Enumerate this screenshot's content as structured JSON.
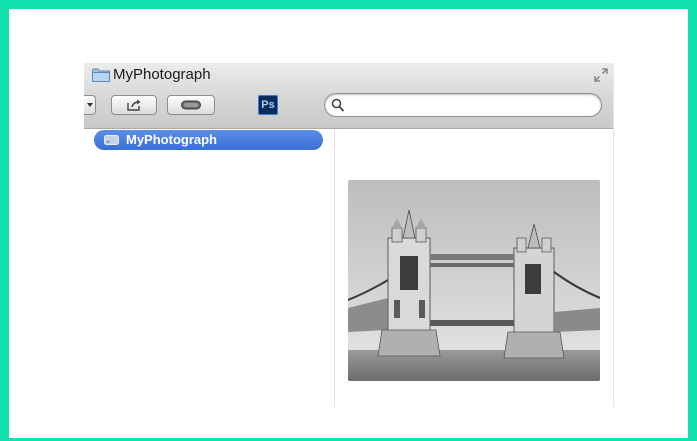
{
  "window": {
    "title": "MyPhotograph"
  },
  "toolbar": {
    "ps_label": "Ps",
    "search": {
      "value": "",
      "placeholder": ""
    }
  },
  "sidebar": {
    "items": [
      {
        "label": "MyPhotograph",
        "selected": true,
        "icon": "drive-icon"
      }
    ]
  },
  "preview": {
    "image": "tower-bridge-photo-grayscale"
  },
  "colors": {
    "frame_border": "#12e3ae",
    "selection": "#3a6fd6",
    "ps_background": "#0b2a5c"
  }
}
